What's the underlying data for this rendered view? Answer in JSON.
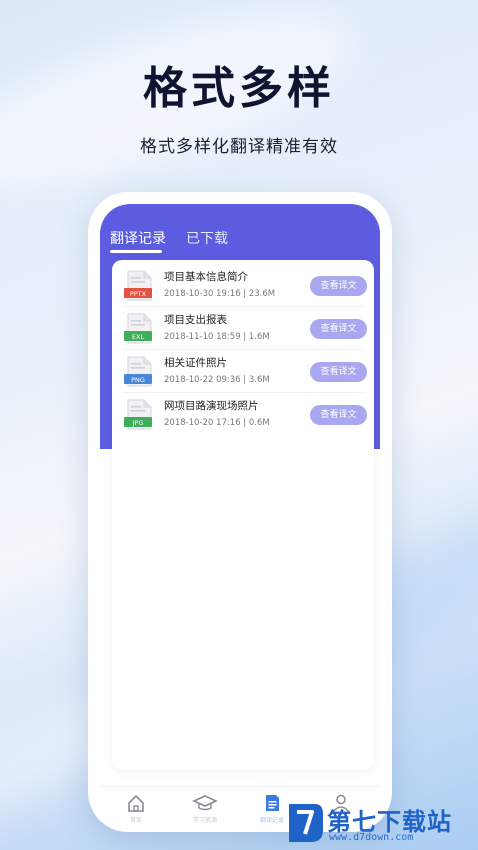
{
  "headline": "格式多样",
  "subheadline": "格式多样化翻译精准有效",
  "tabs": [
    {
      "label": "翻译记录",
      "active": true
    },
    {
      "label": "已下载",
      "active": false
    }
  ],
  "files": [
    {
      "badge": "PPTX",
      "badge_color": "#e3523f",
      "name": "项目基本信息简介",
      "meta": "2018-10-30 19:16 | 23.6M",
      "action": "查看译文"
    },
    {
      "badge": "EXL",
      "badge_color": "#3fae5a",
      "name": "项目支出报表",
      "meta": "2018-11-10 18:59 | 1.6M",
      "action": "查看译文"
    },
    {
      "badge": "PNG",
      "badge_color": "#4a86d8",
      "name": "相关证件照片",
      "meta": "2018-10-22 09:36 | 3.6M",
      "action": "查看译文"
    },
    {
      "badge": "JPG",
      "badge_color": "#3fae5a",
      "name": "网项目路演现场照片",
      "meta": "2018-10-20 17:16 | 0.6M",
      "action": "查看译文"
    }
  ],
  "colors": {
    "accent": "#5b5ce0",
    "button": "#a8a7f0",
    "watermark": "#1f63c7"
  },
  "nav": [
    {
      "icon": "home-icon",
      "label": "首页",
      "active": false
    },
    {
      "icon": "graduation-cap-icon",
      "label": "学习资源",
      "active": false
    },
    {
      "icon": "document-icon",
      "label": "翻译记录",
      "active": true
    },
    {
      "icon": "person-icon",
      "label": "我的",
      "active": false
    }
  ],
  "watermark": {
    "text": "第七下载站",
    "url": "www.d7down.com"
  }
}
